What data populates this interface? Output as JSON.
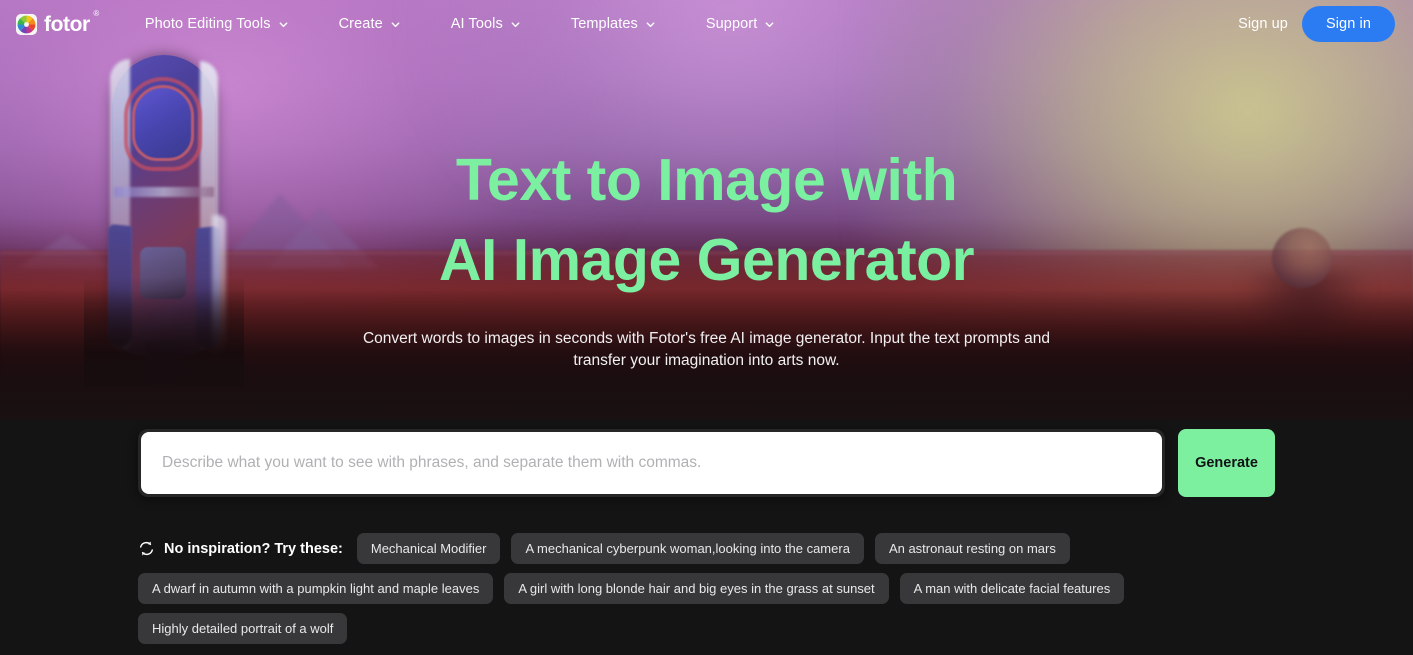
{
  "navbar": {
    "brand": {
      "name": "fotor",
      "trademark": "®",
      "icon": "fotor-logo-icon"
    },
    "items": [
      {
        "label": "Photo Editing Tools",
        "icon": "chevron-down-icon"
      },
      {
        "label": "Create",
        "icon": "chevron-down-icon"
      },
      {
        "label": "AI Tools",
        "icon": "chevron-down-icon"
      },
      {
        "label": "Templates",
        "icon": "chevron-down-icon"
      },
      {
        "label": "Support",
        "icon": "chevron-down-icon"
      }
    ],
    "sign_up": "Sign up",
    "sign_in": "Sign in",
    "sign_in_color": "#2b7cf2"
  },
  "hero": {
    "headline_line1": "Text to Image with",
    "headline_line2": "AI Image Generator",
    "headline_color": "#7df0a0",
    "subhead": "Convert words to images in seconds with Fotor's free AI image generator. Input the text prompts and transfer your imagination into arts now."
  },
  "prompt": {
    "value": "",
    "placeholder": "Describe what you want to see with phrases, and separate them with commas.",
    "generate_label": "Generate",
    "generate_color": "#7df0a0"
  },
  "suggestions": {
    "icon": "refresh-icon",
    "label": "No inspiration? Try these:",
    "chips": [
      "Mechanical Modifier",
      "A mechanical cyberpunk woman,looking into the camera",
      "An astronaut resting on mars",
      "A dwarf in autumn with a pumpkin light and maple leaves",
      "A girl with long blonde hair and big eyes in the grass at sunset",
      "A man with delicate facial features",
      "Highly detailed portrait of a wolf"
    ]
  }
}
